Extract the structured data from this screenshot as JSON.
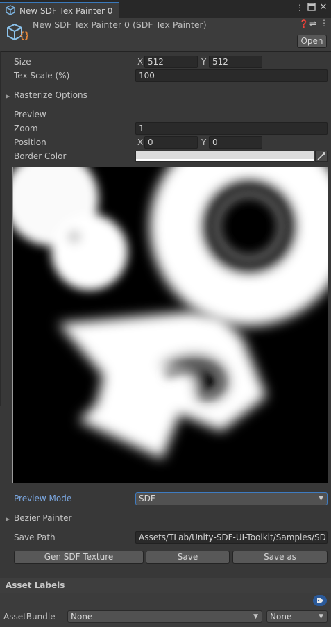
{
  "tab": {
    "title": "New SDF Tex Painter 0",
    "menu_icon": "kebab-menu-icon",
    "maximize_icon": "maximize-icon",
    "close_icon": "close-icon"
  },
  "header": {
    "title": "New SDF Tex Painter 0 (SDF Tex Painter)",
    "open_label": "Open"
  },
  "size": {
    "label": "Size",
    "x_label": "X",
    "x_value": "512",
    "y_label": "Y",
    "y_value": "512"
  },
  "tex_scale": {
    "label": "Tex Scale (%)",
    "value": "100"
  },
  "rasterize": {
    "label": "Rasterize Options",
    "expanded": false
  },
  "preview": {
    "heading": "Preview",
    "zoom_label": "Zoom",
    "zoom_value": "1",
    "position_label": "Position",
    "pos_x_label": "X",
    "pos_x": "0",
    "pos_y_label": "Y",
    "pos_y": "0",
    "border_color_label": "Border Color",
    "border_color": "#e0e0e0"
  },
  "preview_mode": {
    "label": "Preview Mode",
    "value": "SDF"
  },
  "bezier": {
    "label": "Bezier Painter",
    "expanded": false
  },
  "save_path": {
    "label": "Save Path",
    "value": "Assets/TLab/Unity-SDF-UI-Toolkit/Samples/SD"
  },
  "actions": {
    "gen_label": "Gen SDF Texture",
    "save_label": "Save",
    "save_as_label": "Save as"
  },
  "asset_labels": {
    "title": "Asset Labels",
    "tag_icon": "tag-icon"
  },
  "asset_bundle": {
    "label": "AssetBundle",
    "name_value": "None",
    "variant_value": "None"
  },
  "colors": {
    "accent": "#3a79bb",
    "link_label": "#7ba7e0",
    "background": "#383838"
  }
}
